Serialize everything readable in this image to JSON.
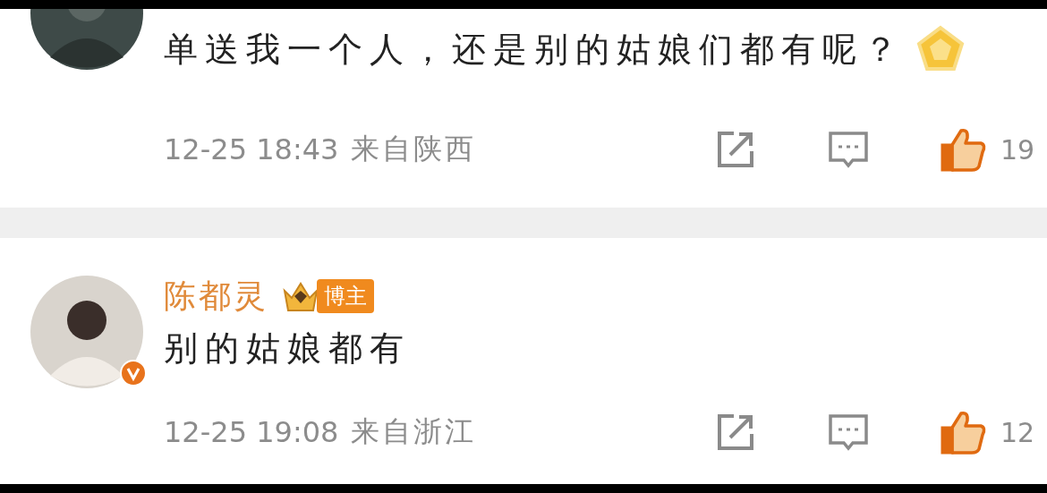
{
  "comments": [
    {
      "text": "单送我一个人，还是别的姑娘们都有呢？",
      "sticker": true,
      "verified": false,
      "time": "12-25 18:43",
      "location": "来自陕西",
      "likes": "19",
      "liked": true
    },
    {
      "name": "陈都灵",
      "badge": "博主",
      "verified": true,
      "text": "别的姑娘都有",
      "sticker": false,
      "time": "12-25 19:08",
      "location": "来自浙江",
      "likes": "12",
      "liked": true
    }
  ]
}
